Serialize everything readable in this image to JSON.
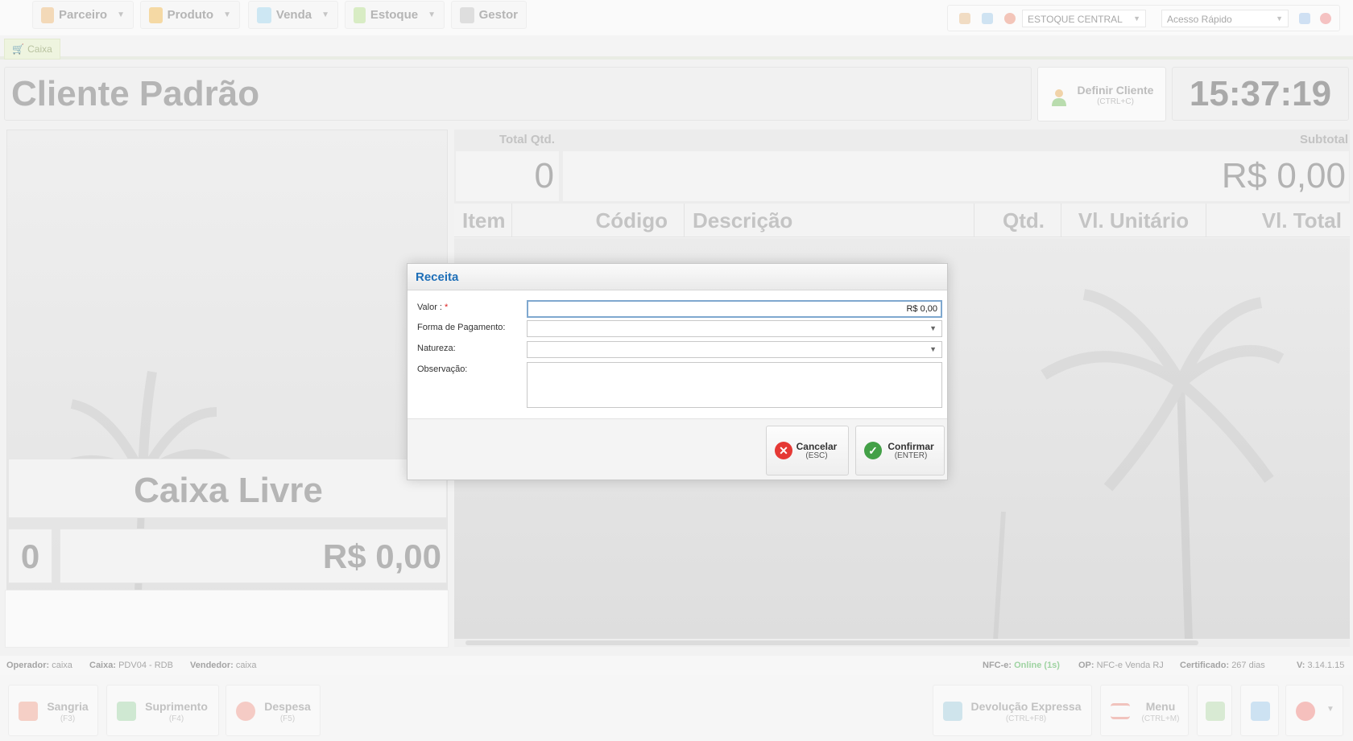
{
  "colors": {
    "accent": "#1e6fb8",
    "cancel": "#e53935",
    "confirm": "#43a047",
    "online": "#9fd3a2"
  },
  "topmenu": [
    {
      "label": "Parceiro",
      "icon": "people-icon"
    },
    {
      "label": "Produto",
      "icon": "box-icon"
    },
    {
      "label": "Venda",
      "icon": "cart-icon"
    },
    {
      "label": "Estoque",
      "icon": "stock-icon"
    },
    {
      "label": "Gestor",
      "icon": "chart-icon"
    }
  ],
  "toolbar": {
    "estoque_value": "ESTOQUE CENTRAL",
    "acesso_placeholder": "Acesso Rápido"
  },
  "tabs": {
    "caixa": "Caixa"
  },
  "header": {
    "client_name": "Cliente Padrão",
    "definir_label": "Definir Cliente",
    "definir_shortcut": "(CTRL+C)",
    "clock": "15:37:19"
  },
  "left": {
    "status": "Caixa Livre",
    "count": "0",
    "total": "R$ 0,00"
  },
  "summary": {
    "total_qtd_label": "Total Qtd.",
    "subtotal_label": "Subtotal",
    "total_qtd": "0",
    "subtotal": "R$ 0,00"
  },
  "grid": {
    "columns": [
      "Item",
      "Código",
      "Descrição",
      "Qtd.",
      "Vl. Unitário",
      "Vl. Total"
    ]
  },
  "statusbar": {
    "operador_label": "Operador:",
    "operador": "caixa",
    "caixa_label": "Caixa:",
    "caixa": "PDV04 - RDB",
    "vendedor_label": "Vendedor:",
    "vendedor": "caixa",
    "nfce_label": "NFC-e:",
    "nfce": "Online (1s)",
    "op_label": "OP:",
    "op": "NFC-e Venda RJ",
    "cert_label": "Certificado:",
    "cert": "267 dias",
    "version_label": "V:",
    "version": "3.14.1.15"
  },
  "actions": {
    "sangria": "Sangria",
    "sangria_key": "(F3)",
    "suprimento": "Suprimento",
    "suprimento_key": "(F4)",
    "despesa": "Despesa",
    "despesa_key": "(F5)",
    "devolucao": "Devolução Expressa",
    "devolucao_key": "(CTRL+F8)",
    "menu": "Menu",
    "menu_key": "(CTRL+M)"
  },
  "modal": {
    "title": "Receita",
    "valor_label": "Valor :",
    "valor_required": "*",
    "valor": "R$ 0,00",
    "forma_label": "Forma de Pagamento:",
    "forma_value": "",
    "natureza_label": "Natureza:",
    "natureza_value": "",
    "obs_label": "Observação:",
    "obs_value": "",
    "cancel_label": "Cancelar",
    "cancel_key": "(ESC)",
    "confirm_label": "Confirmar",
    "confirm_key": "(ENTER)"
  }
}
